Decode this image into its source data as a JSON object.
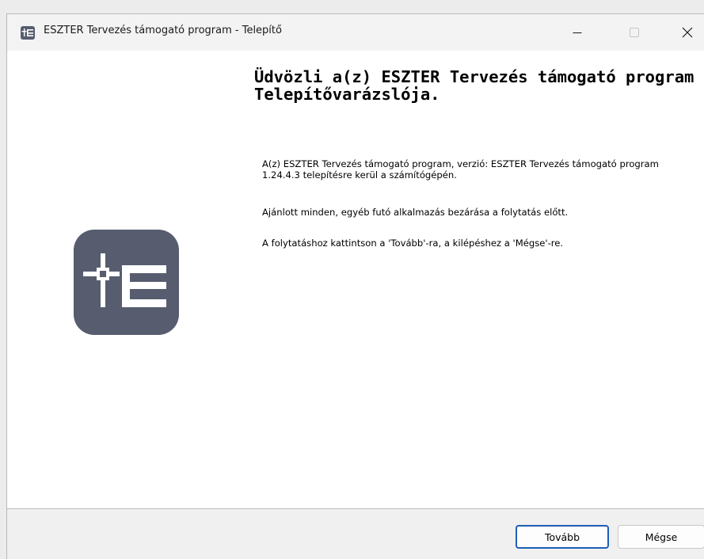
{
  "window": {
    "title": "ESZTER Tervezés támogató program - Telepítő",
    "controls": {
      "minimize_icon": "minimize-icon",
      "maximize_icon": "maximize-icon",
      "close_icon": "close-icon"
    }
  },
  "main": {
    "heading": "Üdvözli a(z) ESZTER Tervezés támogató program Telepítővarázslója.",
    "paragraphs": [
      "A(z) ESZTER Tervezés támogató program, verzió: ESZTER Tervezés támogató program 1.24.4.3 telepítésre kerül a számítógépén.",
      "Ajánlott minden, egyéb futó alkalmazás bezárása a folytatás előtt.",
      "A folytatáshoz kattintson a 'Tovább'-ra, a kilépéshez a 'Mégse'-re."
    ],
    "logo_icon": "eszter-logo-icon"
  },
  "footer": {
    "next_label": "Tovább",
    "cancel_label": "Mégse"
  },
  "colors": {
    "logo_bg": "#575d6f",
    "default_button_border": "#1d5fb8"
  }
}
